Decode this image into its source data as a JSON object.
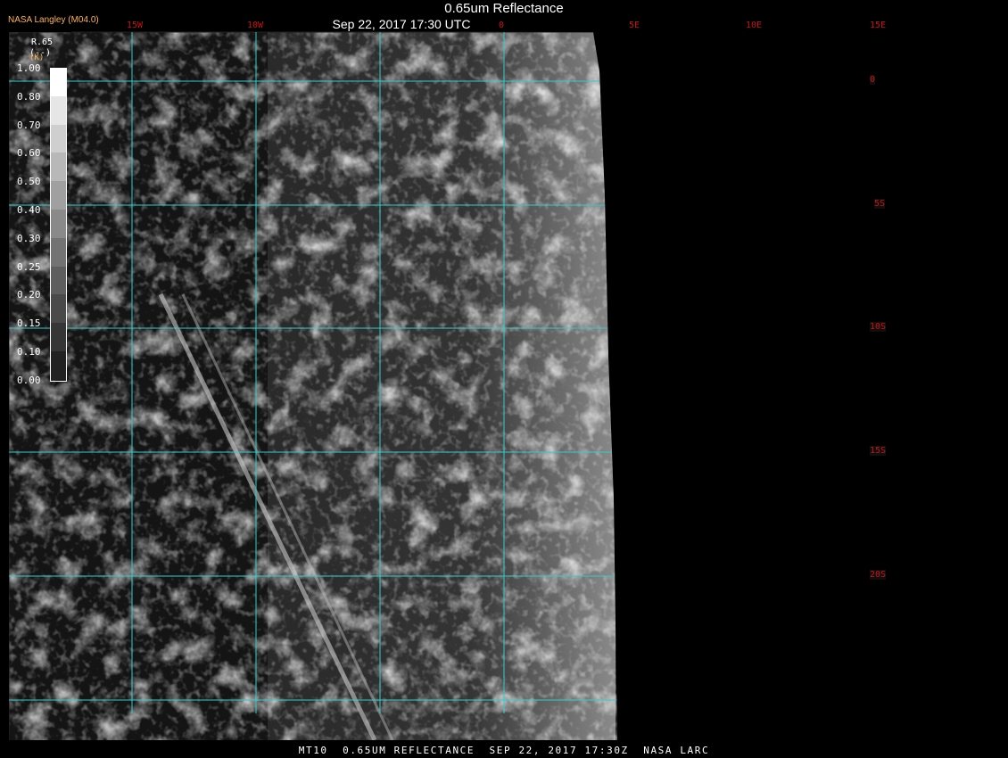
{
  "header": {
    "title": "0.65um Reflectance",
    "datetime": "Sep 22, 2017 17:30 UTC",
    "brand": "NASA Langley (M04.0)"
  },
  "footer": {
    "caption": "MT10  0.65UM REFLECTANCE  SEP 22, 2017 17:30Z  NASA LARC"
  },
  "legend": {
    "title_line1": "R.65",
    "title_line2": "(--)",
    "unit": "(K)",
    "ticks": [
      "1.00",
      "0.80",
      "0.70",
      "0.60",
      "0.50",
      "0.40",
      "0.30",
      "0.25",
      "0.20",
      "0.15",
      "0.10",
      "0.00"
    ]
  },
  "map": {
    "longitude_labels": [
      "15W",
      "10W",
      "0",
      "5E",
      "10E",
      "15E"
    ],
    "latitude_labels": [
      "0",
      "5S",
      "10S",
      "15S",
      "20S"
    ],
    "colors": {
      "grid": "#33cccc",
      "label": "#cc1111",
      "coastline": "#ffffff",
      "background": "#000000"
    }
  }
}
